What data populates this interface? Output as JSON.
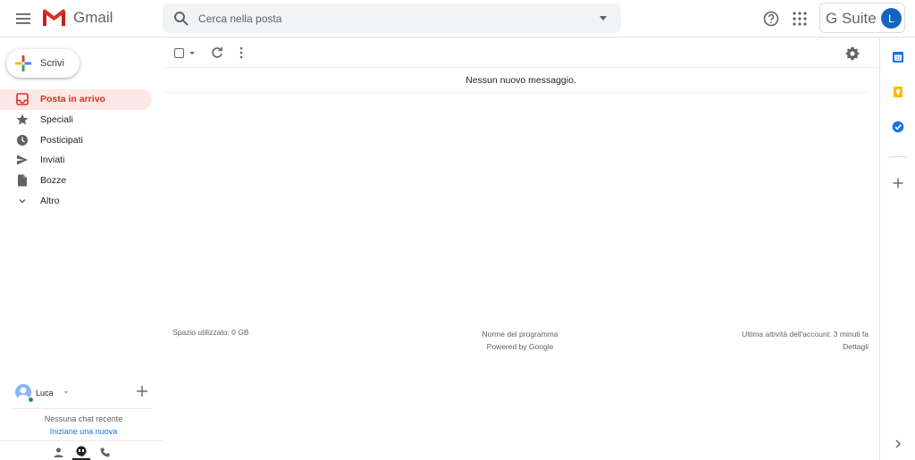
{
  "header": {
    "app_name": "Gmail",
    "search_placeholder": "Cerca nella posta",
    "brand": "G Suite",
    "avatar_initial": "L",
    "colors": {
      "gmail_red": "#d93025",
      "avatar_bg": "#1565c0"
    }
  },
  "sidebar": {
    "compose_label": "Scrivi",
    "items": [
      {
        "label": "Posta in arrivo",
        "icon": "inbox-icon",
        "active": true
      },
      {
        "label": "Speciali",
        "icon": "star-icon",
        "active": false
      },
      {
        "label": "Posticipati",
        "icon": "clock-icon",
        "active": false
      },
      {
        "label": "Inviati",
        "icon": "send-icon",
        "active": false
      },
      {
        "label": "Bozze",
        "icon": "draft-icon",
        "active": false
      },
      {
        "label": "Altro",
        "icon": "chevron-down-icon",
        "active": false
      }
    ],
    "chat": {
      "user_name": "Luca",
      "empty_text": "Nessuna chat recente",
      "start_link": "Iniziane una nuova"
    }
  },
  "main": {
    "empty_message": "Nessun nuovo messaggio.",
    "footer": {
      "storage": "Spazio utilizzato: 0 GB",
      "terms": "Norme del programma",
      "powered": "Powered by Google",
      "last_activity": "Ultima attività dell'account: 3 minuti fa",
      "details": "Dettagli"
    }
  },
  "right_panel": {
    "apps": [
      "calendar-icon",
      "keep-icon",
      "tasks-icon"
    ]
  }
}
